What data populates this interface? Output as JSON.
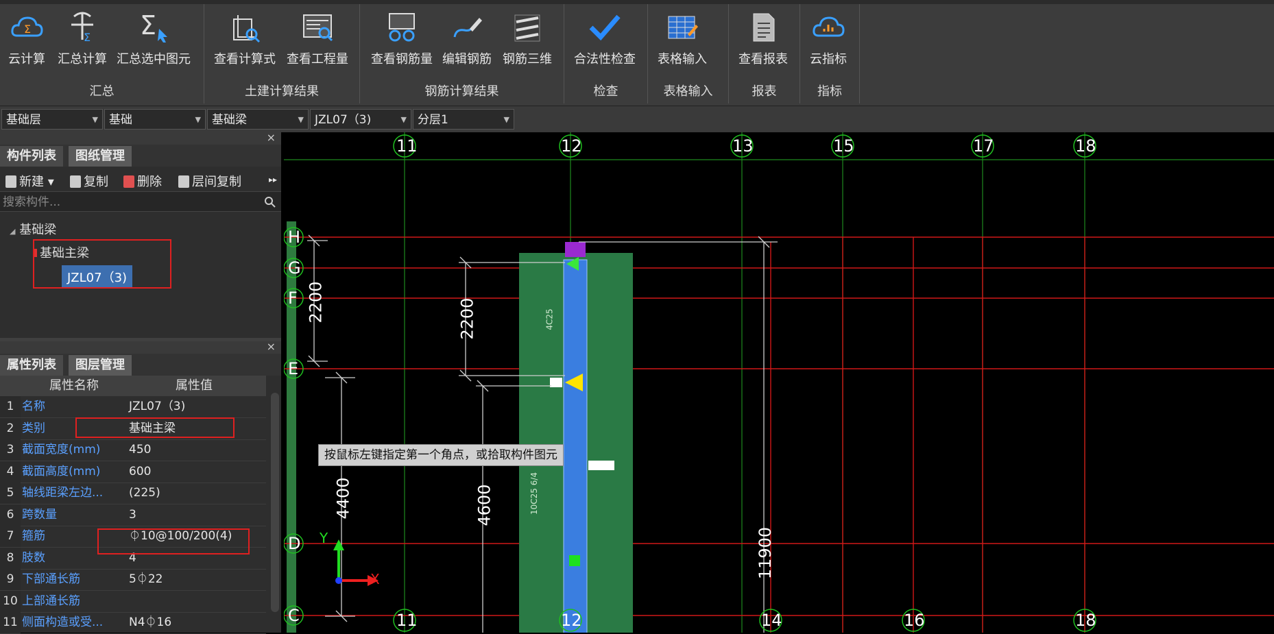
{
  "ribbon": {
    "groups": [
      {
        "name": "汇总",
        "buttons": [
          "云计算",
          "汇总计算",
          "汇总选中图元"
        ]
      },
      {
        "name": "土建计算结果",
        "buttons": [
          "查看计算式",
          "查看工程量"
        ]
      },
      {
        "name": "钢筋计算结果",
        "buttons": [
          "查看钢筋量",
          "编辑钢筋",
          "钢筋三维"
        ]
      },
      {
        "name": "检查",
        "buttons": [
          "合法性检查"
        ]
      },
      {
        "name": "表格输入",
        "buttons": [
          "表格输入"
        ]
      },
      {
        "name": "报表",
        "buttons": [
          "查看报表"
        ]
      },
      {
        "name": "指标",
        "buttons": [
          "云指标"
        ]
      }
    ]
  },
  "filters": [
    "基础层",
    "基础",
    "基础梁",
    "JZL07（3)",
    "分层1"
  ],
  "component_panel": {
    "tabs": [
      "构件列表",
      "图纸管理"
    ],
    "toolbar": {
      "new": "新建",
      "copy": "复制",
      "delete": "删除",
      "floor_copy": "层间复制",
      "more": "▸▸"
    },
    "search_placeholder": "搜索构件...",
    "tree": {
      "root": "基础梁",
      "child": "基础主梁",
      "selected": "JZL07（3)"
    }
  },
  "property_panel": {
    "tabs": [
      "属性列表",
      "图层管理"
    ],
    "headers": {
      "name": "属性名称",
      "value": "属性值"
    },
    "rows": [
      {
        "num": "1",
        "name": "名称",
        "value": "JZL07（3)"
      },
      {
        "num": "2",
        "name": "类别",
        "value": "基础主梁"
      },
      {
        "num": "3",
        "name": "截面宽度(mm)",
        "value": "450"
      },
      {
        "num": "4",
        "name": "截面高度(mm)",
        "value": "600"
      },
      {
        "num": "5",
        "name": "轴线距梁左边...",
        "value": "(225)"
      },
      {
        "num": "6",
        "name": "跨数量",
        "value": "3"
      },
      {
        "num": "7",
        "name": "箍筋",
        "value": "⏀10@100/200(4)"
      },
      {
        "num": "8",
        "name": "肢数",
        "value": "4"
      },
      {
        "num": "9",
        "name": "下部通长筋",
        "value": "5⏀22"
      },
      {
        "num": "10",
        "name": "上部通长筋",
        "value": ""
      },
      {
        "num": "11",
        "name": "侧面构造或受...",
        "value": "N4⏀16"
      }
    ]
  },
  "canvas": {
    "top_axes": [
      "11",
      "12",
      "13",
      "15",
      "17",
      "18"
    ],
    "bottom_axes": [
      "11",
      "12",
      "14",
      "16",
      "18"
    ],
    "left_axes": [
      "H",
      "G",
      "F",
      "E",
      "D",
      "C"
    ],
    "dimensions": [
      "2200",
      "2200",
      "4400",
      "4600",
      "11900"
    ],
    "beam_labels": [
      "4C25",
      "10C25 6/4"
    ],
    "tooltip": "按鼠标左键指定第一个角点，或拾取构件图元",
    "ucs": {
      "x": "X",
      "y": "Y"
    }
  }
}
